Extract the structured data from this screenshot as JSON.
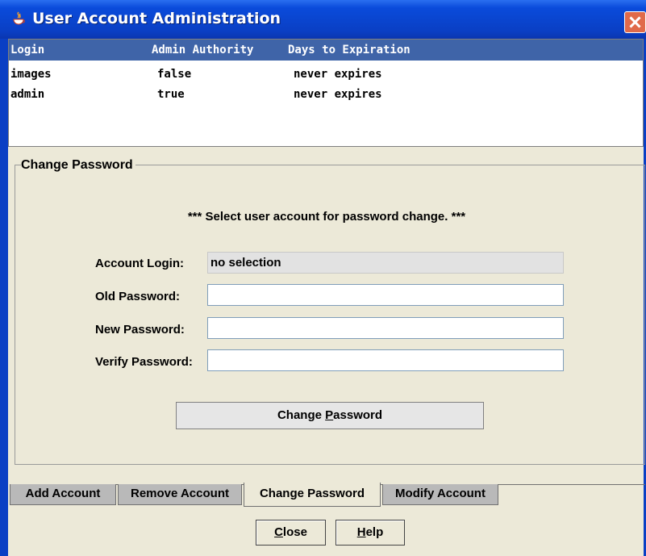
{
  "window": {
    "title": "User Account Administration"
  },
  "table": {
    "columns": [
      "Login",
      "Admin Authority",
      "Days to Expiration"
    ],
    "rows": [
      [
        "images",
        "false",
        "never expires"
      ],
      [
        "admin",
        "true",
        "never expires"
      ]
    ]
  },
  "change_password": {
    "group_title": "Change Password",
    "notice": "*** Select user account for password change. ***",
    "account_login_label": "Account Login:",
    "account_login_value": "no selection",
    "old_password_label": "Old Password:",
    "old_password_value": "",
    "new_password_label": "New Password:",
    "new_password_value": "",
    "verify_password_label": "Verify Password:",
    "verify_password_value": "",
    "button_prefix": "Change ",
    "button_mnemonic": "P",
    "button_suffix": "assword"
  },
  "tabs": [
    "Add Account",
    "Remove Account",
    "Change Password",
    "Modify Account"
  ],
  "active_tab": "Change Password",
  "buttons": {
    "close_mnemonic": "C",
    "close_rest": "lose",
    "help_mnemonic": "H",
    "help_rest": "elp"
  },
  "colors": {
    "title_bar": "#0a3fc4",
    "table_header": "#3f64a8",
    "window_bg": "#ece9d8"
  }
}
